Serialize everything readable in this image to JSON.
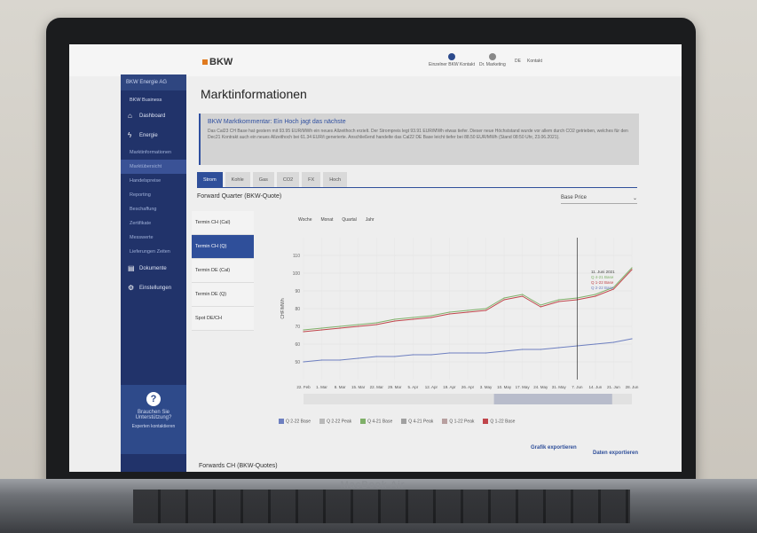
{
  "header": {
    "logo": "BKW",
    "user_name": "Dr. Marketing",
    "language": "DE",
    "contact": "Kontakt",
    "logout": "Einzelner BKW Kontakt"
  },
  "sidebar": {
    "company": "BKW Energie AG",
    "business": "BKW Business",
    "items": [
      {
        "label": "Dashboard",
        "icon": "home-icon"
      },
      {
        "label": "Energie",
        "icon": "lightning-icon"
      },
      {
        "label": "Marktinformationen",
        "sub": true
      },
      {
        "label": "Marktübersicht",
        "sub": true,
        "active": true
      },
      {
        "label": "Handelspreise",
        "sub": true
      },
      {
        "label": "Reporting",
        "sub": true
      },
      {
        "label": "Beschaffung",
        "sub": true
      },
      {
        "label": "Zertifikate",
        "sub": true
      },
      {
        "label": "Messwerte",
        "sub": true
      },
      {
        "label": "Lieferungen Zeiten",
        "sub": true
      },
      {
        "label": "Dokumente",
        "icon": "document-icon"
      },
      {
        "label": "Einstellungen",
        "icon": "gear-icon"
      }
    ],
    "help_title": "Brauchen Sie Unterstützung?",
    "help_link": "Experten kontaktieren"
  },
  "main": {
    "title": "Marktinformationen",
    "comment_title": "BKW Marktkommentar: Ein Hoch jagt das nächste",
    "comment_text": "Das Cal23 CH Base hat gestern mit 93.95 EUR/MWh ein neues Allzeithoch erzielt. Der Strompreis legt 93.91 EUR/MWh etwas tiefer. Dieser neue Höchststand wurde vor allem durch CO2 getrieben, welches für den Dec21 Kontrakt auch ein neues Allzeithoch bei 61.34 EUR/t generierte. Anschließend handelte das Cal22 DE Base leicht tiefer bei 88.50 EUR/MWh (Stand 08:50 Uhr, 23.06.2021).",
    "tabs": [
      "Strom",
      "Kohle",
      "Gas",
      "CO2",
      "FX",
      "Hoch"
    ],
    "section_title": "Forward Quarter (BKW-Quote)",
    "select_value": "Base Price",
    "terms": [
      "Termin CH (Cal)",
      "Termin CH (Q)",
      "Termin DE (Cal)",
      "Termin DE (Q)",
      "Spot DE/CH"
    ],
    "periods": [
      "Woche",
      "Monat",
      "Quartal",
      "Jahr"
    ],
    "export_graph": "Grafik exportieren",
    "export_data": "Daten exportieren",
    "forwards_title": "Forwards CH (BKW-Quotes)"
  },
  "chart_data": {
    "type": "line",
    "ylabel": "CHF/MWh",
    "ylim": [
      40,
      120
    ],
    "y_ticks": [
      50,
      60,
      70,
      80,
      90,
      100,
      110
    ],
    "x": [
      "22. Feb",
      "1. Mar",
      "8. Mar",
      "15. Mar",
      "22. Mar",
      "29. Mar",
      "5. Apr",
      "12. Apr",
      "19. Apr",
      "26. Apr",
      "3. May",
      "10. May",
      "17. May",
      "24. May",
      "31. May",
      "7. Jun",
      "14. Jun",
      "21. Jun",
      "28. Jun"
    ],
    "series": [
      {
        "name": "Q 4-21 Base",
        "color": "#7fb069",
        "values": [
          68,
          69,
          70,
          71,
          72,
          74,
          75,
          76,
          78,
          79,
          80,
          86,
          88,
          82,
          85,
          86,
          88,
          92,
          103
        ]
      },
      {
        "name": "Q 1-22 Base",
        "color": "#c0454b",
        "values": [
          67,
          68,
          69,
          70,
          71,
          73,
          74,
          75,
          77,
          78,
          79,
          85,
          87,
          81,
          84,
          85,
          87,
          91,
          102
        ]
      },
      {
        "name": "Q 2-22 Base",
        "color": "#6d7fc0",
        "values": [
          50,
          51,
          51,
          52,
          53,
          53,
          54,
          54,
          55,
          55,
          55,
          56,
          57,
          57,
          58,
          59,
          60,
          61,
          63
        ]
      }
    ],
    "legend": [
      "Q 2-22 Base",
      "Q 2-22 Peak",
      "Q 4-21 Base",
      "Q 4-21 Peak",
      "Q 1-22 Peak",
      "Q 1-22 Base"
    ],
    "legend_colors": [
      "#6d7fc0",
      "#b8b8b8",
      "#7fb069",
      "#a0a0a0",
      "#b8a0a0",
      "#c0454b"
    ],
    "tooltip": [
      "11. Juni 2021",
      "Q 4-21 Base",
      "Q 1-22 Base",
      "Q 2-22 Base"
    ],
    "grid": true,
    "legend_position": "bottom"
  }
}
